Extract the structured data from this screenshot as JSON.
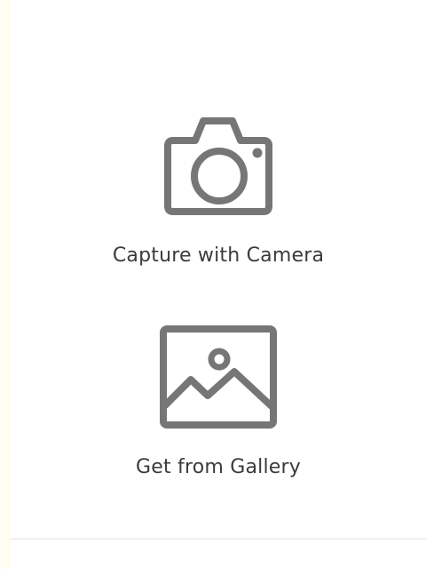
{
  "options": [
    {
      "id": "camera",
      "label": "Capture with Camera",
      "icon": "camera-icon"
    },
    {
      "id": "gallery",
      "label": "Get from Gallery",
      "icon": "image-icon"
    }
  ],
  "colors": {
    "background": "#fffdf2",
    "panel": "#ffffff",
    "icon": "#767676",
    "text": "#3b3b3b",
    "divider": "#efefef"
  }
}
